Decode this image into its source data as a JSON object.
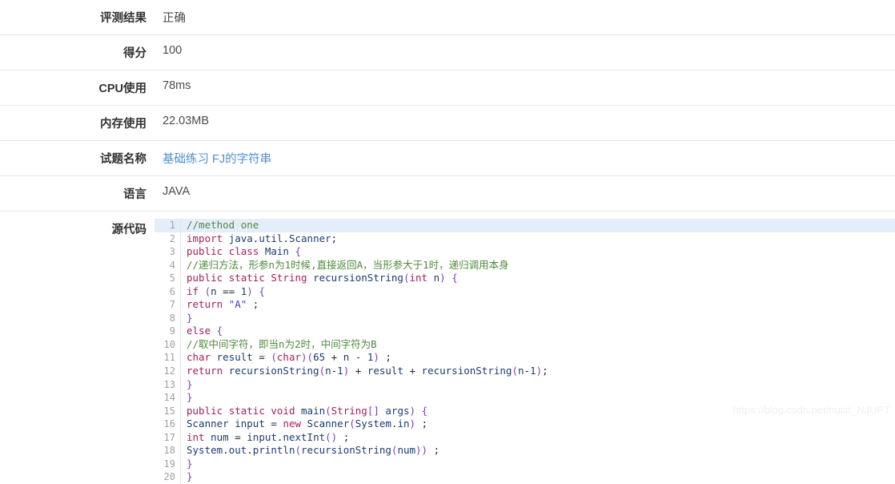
{
  "rows": [
    {
      "label": "评测结果",
      "value": "正确",
      "kind": "text"
    },
    {
      "label": "得分",
      "value": "100",
      "kind": "text"
    },
    {
      "label": "CPU使用",
      "value": "78ms",
      "kind": "text"
    },
    {
      "label": "内存使用",
      "value": "22.03MB",
      "kind": "text"
    },
    {
      "label": "试题名称",
      "value": "基础练习 FJ的字符串",
      "kind": "link"
    },
    {
      "label": "语言",
      "value": "JAVA",
      "kind": "text"
    },
    {
      "label": "源代码",
      "value": "",
      "kind": "code"
    }
  ],
  "labels": {
    "result": "评测结果",
    "score": "得分",
    "cpu": "CPU使用",
    "memory": "内存使用",
    "problem": "试题名称",
    "language": "语言",
    "source": "源代码"
  },
  "values": {
    "result": "正确",
    "score": "100",
    "cpu": "78ms",
    "memory": "22.03MB",
    "problem": "基础练习 FJ的字符串",
    "language": "JAVA"
  },
  "code": {
    "language": "JAVA",
    "highlighted_line": 1,
    "line_count": 20,
    "lines": [
      {
        "n": "1",
        "text": "//method one"
      },
      {
        "n": "2",
        "text": "import java.util.Scanner;"
      },
      {
        "n": "3",
        "text": "public class Main {"
      },
      {
        "n": "4",
        "text": "//递归方法，形参n为1时候,直接返回A，当形参大于1时，递归调用本身"
      },
      {
        "n": "5",
        "text": "public static String recursionString(int n) {"
      },
      {
        "n": "6",
        "text": "if (n == 1) {"
      },
      {
        "n": "7",
        "text": "return \"A\" ;"
      },
      {
        "n": "8",
        "text": "}"
      },
      {
        "n": "9",
        "text": "else {"
      },
      {
        "n": "10",
        "text": "//取中间字符，即当n为2时，中间字符为B"
      },
      {
        "n": "11",
        "text": "char result = (char)(65 + n - 1) ;"
      },
      {
        "n": "12",
        "text": "return recursionString(n-1) + result + recursionString(n-1);"
      },
      {
        "n": "13",
        "text": "}"
      },
      {
        "n": "14",
        "text": "}"
      },
      {
        "n": "15",
        "text": "public static void main(String[] args) {"
      },
      {
        "n": "16",
        "text": "Scanner input = new Scanner(System.in) ;"
      },
      {
        "n": "17",
        "text": "int num = input.nextInt() ;"
      },
      {
        "n": "18",
        "text": "System.out.println(recursionString(num)) ;"
      },
      {
        "n": "19",
        "text": "}"
      },
      {
        "n": "20",
        "text": "}"
      }
    ]
  },
  "watermark": "https://blog.csdn.net/nuist_NJUPT",
  "colors": {
    "link": "#4d8fd1",
    "highlight": "#e4eefb",
    "separator": "#e8e8e8",
    "keyword": "#a71d5d",
    "identifier": "#1b3c6e",
    "string": "#3a3ad6",
    "comment": "#4f8a3d",
    "punctuation": "#7d3fbf",
    "line_number": "#a0a0a0"
  }
}
